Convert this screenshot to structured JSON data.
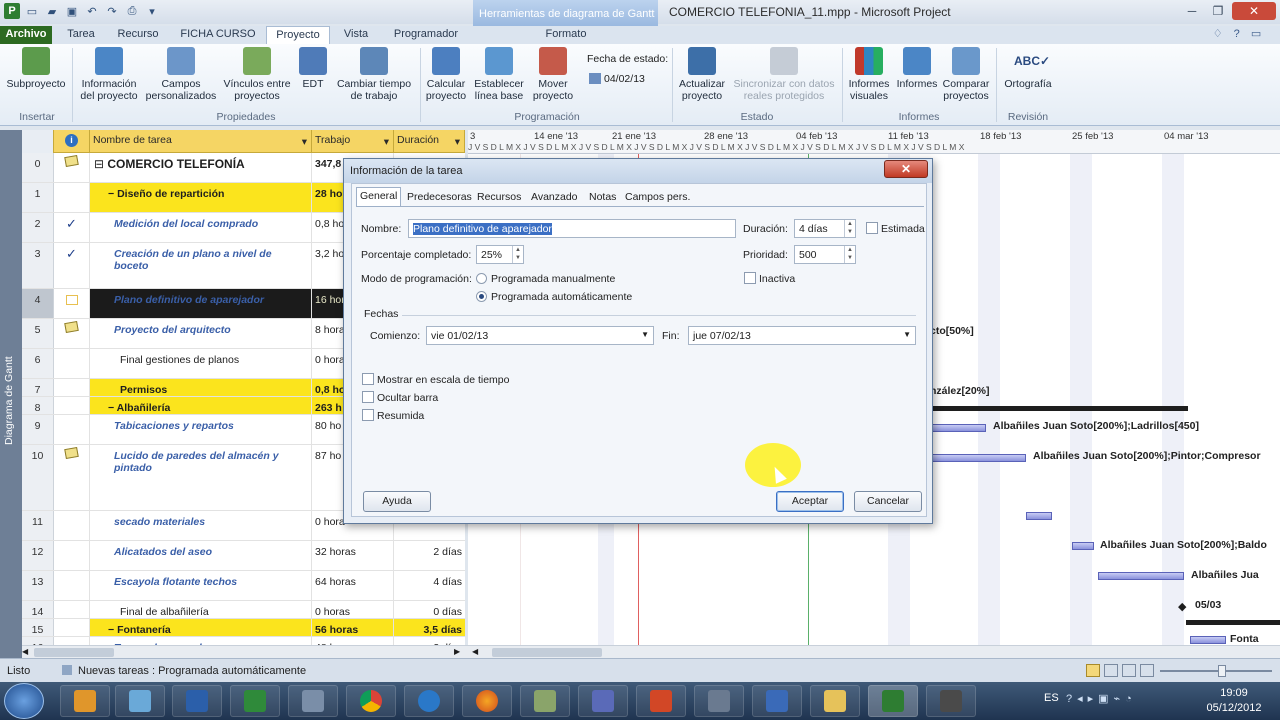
{
  "window": {
    "title": "COMERCIO TELEFONIA_11.mpp - Microsoft Project",
    "context_tab": "Herramientas de diagrama de Gantt"
  },
  "tabs": [
    "Archivo",
    "Tarea",
    "Recurso",
    "FICHA CURSO",
    "Proyecto",
    "Vista",
    "Programador",
    "Formato"
  ],
  "ribbon": {
    "buttons": [
      "Subproyecto",
      "Información del proyecto",
      "Campos personalizados",
      "Vínculos entre proyectos",
      "EDT",
      "Cambiar tiempo de trabajo",
      "Calcular proyecto",
      "Establecer línea base",
      "Mover proyecto",
      "Actualizar proyecto",
      "Sincronizar con datos reales protegidos",
      "Informes visuales",
      "Informes",
      "Comparar proyectos",
      "Ortografía"
    ],
    "groups": [
      "Insertar",
      "Propiedades",
      "Programación",
      "Estado",
      "Informes",
      "Revisión"
    ],
    "status_date_label": "Fecha de estado:",
    "status_date_value": "04/02/13"
  },
  "sidebar_label": "Diagrama de Gantt",
  "grid": {
    "headers": {
      "name": "Nombre de tarea",
      "work": "Trabajo",
      "duration": "Duración"
    },
    "rows": [
      {
        "id": "0",
        "name": "COMERCIO TELEFONÍA",
        "work": "347,8",
        "dur": ""
      },
      {
        "id": "1",
        "name": "Diseño de repartición",
        "work": "28 ho",
        "dur": ""
      },
      {
        "id": "2",
        "name": "Medición del local comprado",
        "work": "0,8 ho",
        "dur": ""
      },
      {
        "id": "3",
        "name": "Creación de un plano a nivel de boceto",
        "work": "3,2 ho",
        "dur": ""
      },
      {
        "id": "4",
        "name": "Plano definitivo de aparejador",
        "work": "16 hor",
        "dur": ""
      },
      {
        "id": "5",
        "name": "Proyecto del arquitecto",
        "work": "8 hora",
        "dur": ""
      },
      {
        "id": "6",
        "name": "Final gestiones de planos",
        "work": "0 hora",
        "dur": ""
      },
      {
        "id": "7",
        "name": "Permisos",
        "work": "0,8 ho",
        "dur": ""
      },
      {
        "id": "8",
        "name": "Albañilería",
        "work": "263 h",
        "dur": ""
      },
      {
        "id": "9",
        "name": "Tabicaciones y repartos",
        "work": "80 ho",
        "dur": ""
      },
      {
        "id": "10",
        "name": "Lucido de paredes del almacén y pintado",
        "work": "87 ho",
        "dur": ""
      },
      {
        "id": "11",
        "name": "secado materiales",
        "work": "0 hora",
        "dur": ""
      },
      {
        "id": "12",
        "name": "Alicatados del aseo",
        "work": "32 horas",
        "dur": "2 días"
      },
      {
        "id": "13",
        "name": "Escayola flotante techos",
        "work": "64 horas",
        "dur": "4 días"
      },
      {
        "id": "14",
        "name": "Final de albañilería",
        "work": "0 horas",
        "dur": "0 días"
      },
      {
        "id": "15",
        "name": "Fontanería",
        "work": "56 horas",
        "dur": "3,5 días"
      },
      {
        "id": "16",
        "name": "Tomas de agua al aseo",
        "work": "48 horas",
        "dur": "3 días"
      }
    ]
  },
  "gantt": {
    "weeks": [
      "3",
      "14 ene '13",
      "21 ene '13",
      "28 ene '13",
      "04 feb '13",
      "11 feb '13",
      "18 feb '13",
      "25 feb '13",
      "04 mar '13"
    ],
    "days": "J V S D L M X J V S D L M X J V S D L M X J V S D L M X J V S D L M X J V S D L M X J V S D L M X J V S D L M X J V S D L M X",
    "labels": [
      "cto[50%]",
      "nzález[20%]",
      "Albañiles Juan Soto[200%];Ladrillos[450]",
      "Albañiles Juan Soto[200%];Pintor;Compresor",
      "Albañiles Juan Soto[200%];Baldo",
      "Albañiles Jua",
      "05/03",
      "Fonta"
    ]
  },
  "dialog": {
    "title": "Información de la tarea",
    "tabs": [
      "General",
      "Predecesoras",
      "Recursos",
      "Avanzado",
      "Notas",
      "Campos pers."
    ],
    "name_label": "Nombre:",
    "name_value": "Plano definitivo de aparejador",
    "duration_label": "Duración:",
    "duration_value": "4 días",
    "estimated_label": "Estimada",
    "percent_label": "Porcentaje completado:",
    "percent_value": "25%",
    "priority_label": "Prioridad:",
    "priority_value": "500",
    "mode_label": "Modo de programación:",
    "mode_manual": "Programada manualmente",
    "mode_auto": "Programada automáticamente",
    "inactive_label": "Inactiva",
    "dates_label": "Fechas",
    "start_label": "Comienzo:",
    "start_value": "vie 01/02/13",
    "finish_label": "Fin:",
    "finish_value": "jue 07/02/13",
    "show_timescale": "Mostrar en escala de tiempo",
    "hide_bar": "Ocultar barra",
    "summarized": "Resumida",
    "help": "Ayuda",
    "ok": "Aceptar",
    "cancel": "Cancelar"
  },
  "status": {
    "ready": "Listo",
    "new_tasks": "Nuevas tareas : Programada automáticamente"
  },
  "taskbar": {
    "lang": "ES",
    "time": "19:09",
    "date": "05/12/2012"
  }
}
